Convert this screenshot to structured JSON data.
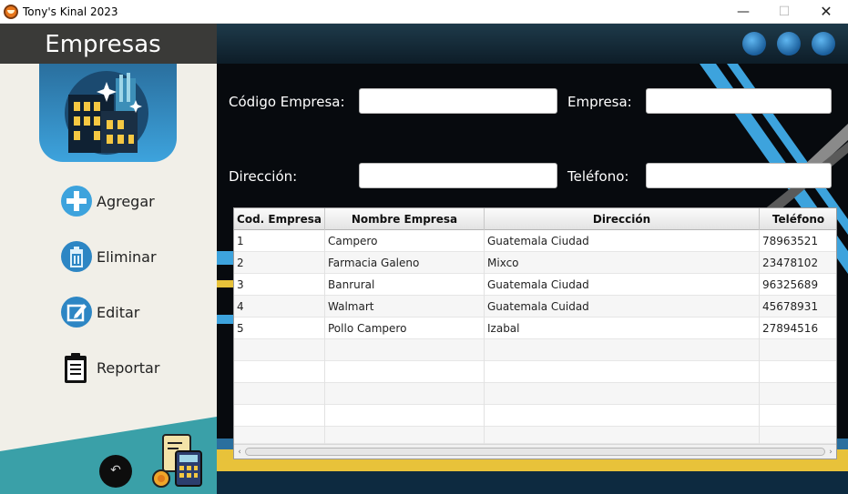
{
  "window": {
    "title": "Tony's Kinal 2023",
    "min_glyph": "—",
    "max_glyph": "☐",
    "close_glyph": "✕"
  },
  "sidebar": {
    "title": "Empresas",
    "menu": [
      {
        "label": "Agregar",
        "icon": "plus-icon"
      },
      {
        "label": "Eliminar",
        "icon": "trash-icon"
      },
      {
        "label": "Editar",
        "icon": "edit-icon"
      },
      {
        "label": "Reportar",
        "icon": "clipboard-icon"
      }
    ],
    "back_glyph": "↶"
  },
  "form": {
    "codigo_label": "Código Empresa:",
    "codigo_value": "",
    "empresa_label": "Empresa:",
    "empresa_value": "",
    "direccion_label": "Dirección:",
    "direccion_value": "",
    "telefono_label": "Teléfono:",
    "telefono_value": ""
  },
  "table": {
    "headers": [
      "Cod. Empresa",
      "Nombre Empresa",
      "Dirección",
      "Teléfono"
    ],
    "rows": [
      [
        "1",
        "Campero",
        "Guatemala Ciudad",
        "78963521"
      ],
      [
        "2",
        "Farmacia Galeno",
        "Mixco",
        "23478102"
      ],
      [
        "3",
        "Banrural",
        "Guatemala Ciudad",
        "96325689"
      ],
      [
        "4",
        "Walmart",
        "Guatemala Cuidad",
        "45678931"
      ],
      [
        "5",
        "Pollo Campero",
        "Izabal",
        "27894516"
      ]
    ]
  },
  "colors": {
    "accent_blue": "#3da3dd",
    "dark_bg": "#070a0e",
    "sidebar_bg": "#f1efe8",
    "teal": "#3aa0a8",
    "gold": "#e8c23a"
  }
}
